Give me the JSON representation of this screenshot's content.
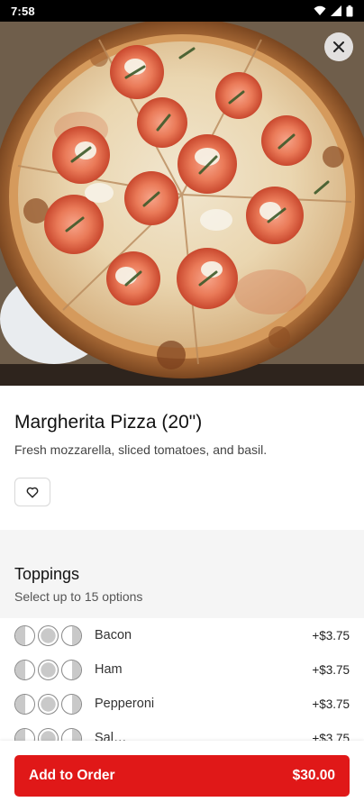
{
  "status_bar": {
    "time": "7:58",
    "icons": [
      "wifi-icon",
      "signal-icon",
      "battery-icon"
    ]
  },
  "hero": {
    "image_subject": "margherita pizza in box",
    "close_icon": "close-icon"
  },
  "item": {
    "title": "Margherita Pizza (20\")",
    "description": "Fresh mozzarella, sliced tomatoes, and basil.",
    "favorite_icon": "heart-outline-icon"
  },
  "toppings": {
    "title": "Toppings",
    "subtitle": "Select up to 15 options",
    "options": [
      {
        "name": "Bacon",
        "price": "+$3.75"
      },
      {
        "name": "Ham",
        "price": "+$3.75"
      },
      {
        "name": "Pepperoni",
        "price": "+$3.75"
      },
      {
        "name": "Sal…",
        "price": "+$3.75"
      }
    ]
  },
  "footer": {
    "add_label": "Add to Order",
    "price": "$30.00"
  },
  "colors": {
    "accent": "#e01818",
    "section_bg": "#f5f5f5"
  }
}
